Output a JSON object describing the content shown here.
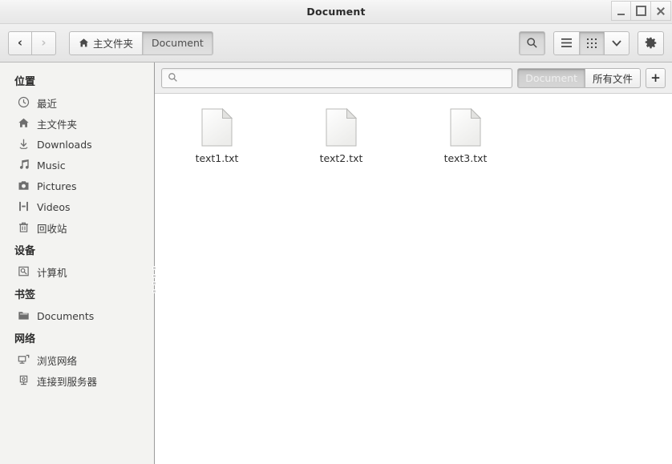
{
  "window": {
    "title": "Document",
    "controls": [
      {
        "name": "minimize",
        "glyph": "_"
      },
      {
        "name": "maximize",
        "glyph": "□"
      },
      {
        "name": "close",
        "glyph": "✕"
      }
    ]
  },
  "toolbar": {
    "back_label": "‹",
    "forward_label": "›",
    "breadcrumbs": [
      {
        "label": "主文件夹",
        "icon": "home-icon",
        "active": false
      },
      {
        "label": "Document",
        "icon": "",
        "active": true
      }
    ],
    "search_button_icon": "search-icon",
    "view_list_icon": "list-view-icon",
    "view_grid_icon": "grid-view-icon",
    "view_more_icon": "chevron-down-icon",
    "settings_icon": "gear-icon"
  },
  "search": {
    "icon": "search-icon",
    "value": "",
    "placeholder": ""
  },
  "filters": {
    "buttons": [
      {
        "label": "Document",
        "active": true
      },
      {
        "label": "所有文件",
        "active": false
      }
    ],
    "add_label": "+"
  },
  "sidebar": {
    "sections": [
      {
        "header": "位置",
        "items": [
          {
            "label": "最近",
            "icon": "clock-icon"
          },
          {
            "label": "主文件夹",
            "icon": "home-icon"
          },
          {
            "label": "Downloads",
            "icon": "download-icon"
          },
          {
            "label": "Music",
            "icon": "music-icon"
          },
          {
            "label": "Pictures",
            "icon": "camera-icon"
          },
          {
            "label": "Videos",
            "icon": "film-icon"
          },
          {
            "label": "回收站",
            "icon": "trash-icon"
          }
        ]
      },
      {
        "header": "设备",
        "items": [
          {
            "label": "计算机",
            "icon": "computer-icon"
          }
        ]
      },
      {
        "header": "书签",
        "items": [
          {
            "label": "Documents",
            "icon": "folder-icon"
          }
        ]
      },
      {
        "header": "网络",
        "items": [
          {
            "label": "浏览网络",
            "icon": "network-browse-icon"
          },
          {
            "label": "连接到服务器",
            "icon": "server-connect-icon"
          }
        ]
      }
    ]
  },
  "files": [
    {
      "name": "text1.txt",
      "icon": "text-file-icon"
    },
    {
      "name": "text2.txt",
      "icon": "text-file-icon"
    },
    {
      "name": "text3.txt",
      "icon": "text-file-icon"
    }
  ],
  "colors": {
    "sidebar_bg": "#f3f3f1",
    "toolbar_bg": "#eaeaea",
    "main_bg": "#ffffff",
    "divider": "#9a9a9a"
  }
}
